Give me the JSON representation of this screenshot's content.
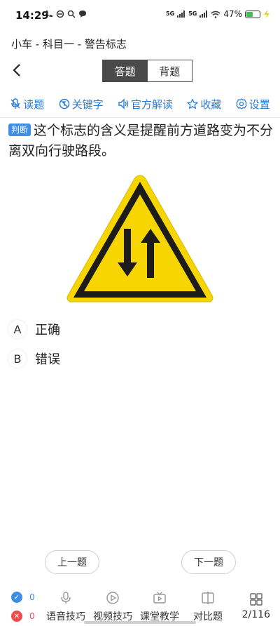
{
  "status_bar": {
    "time": "14:29",
    "net1": "5G",
    "net2": "5G",
    "battery_text": "47%",
    "battery_level": 0.47
  },
  "header": {
    "breadcrumb": "小车 - 科目一 - 警告标志"
  },
  "mode_tabs": {
    "answer_label": "答题",
    "memorize_label": "背题"
  },
  "toolbar": {
    "read_label": "读题",
    "keyword_label": "关键字",
    "official_label": "官方解读",
    "favorite_label": "收藏",
    "settings_label": "设置",
    "accent_color": "#2a7bd8"
  },
  "question": {
    "type_badge": "判断",
    "text": "这个标志的含义是提醒前方道路变为不分离双向行驶路段。"
  },
  "options": [
    {
      "letter": "A",
      "text": "正确"
    },
    {
      "letter": "B",
      "text": "错误"
    }
  ],
  "navigation": {
    "prev_label": "上一题",
    "next_label": "下一题"
  },
  "bottom_bar": {
    "correct_count": "0",
    "wrong_count": "0",
    "voice_tips_label": "语音技巧",
    "video_tips_label": "视频技巧",
    "class_teaching_label": "课堂教学",
    "compare_label": "对比题",
    "page_counter": "2/116"
  }
}
